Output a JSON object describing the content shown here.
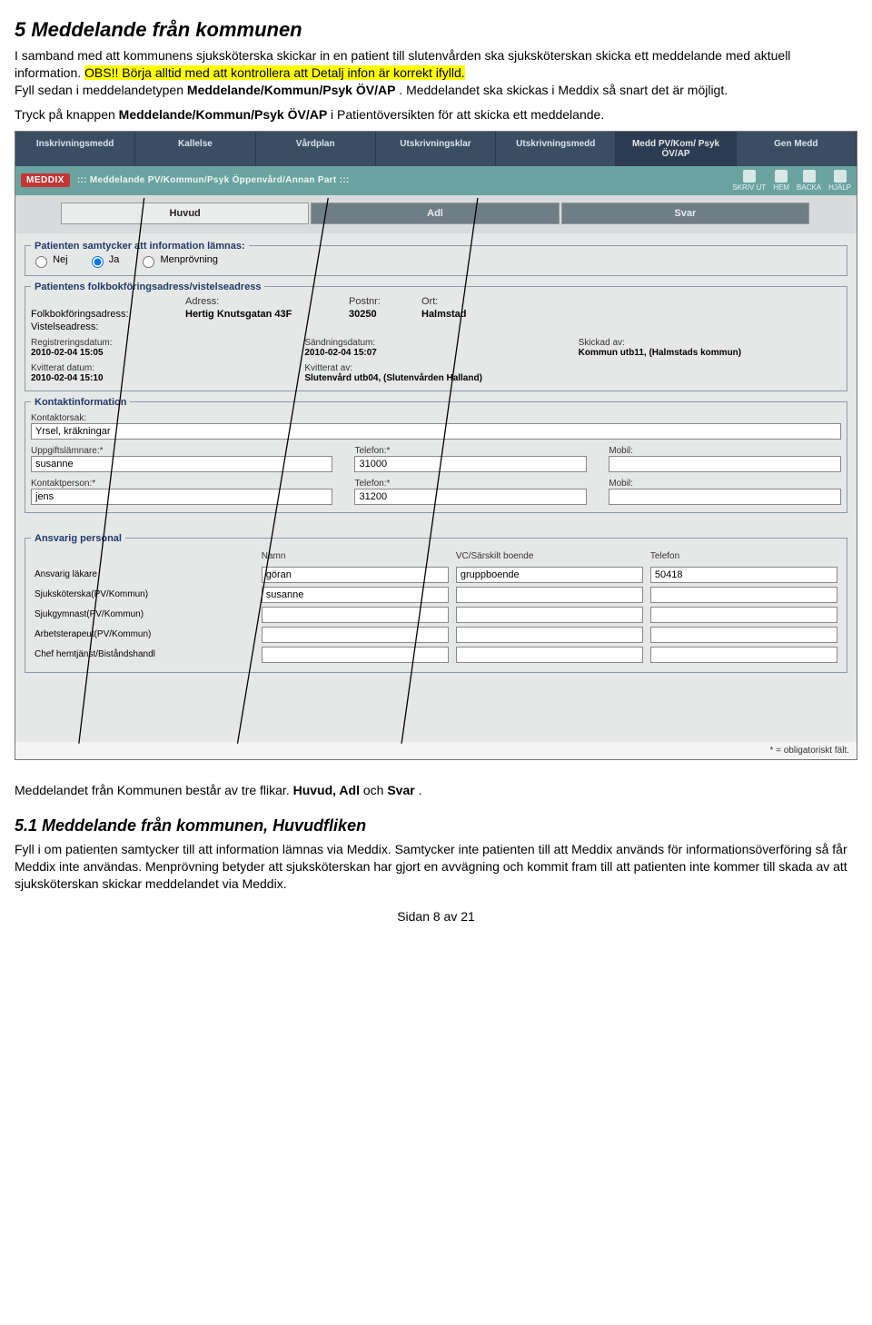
{
  "heading": "5 Meddelande från kommunen",
  "intro_plain": "I samband med att kommunens sjuksköterska skickar in en patient till slutenvården ska sjuksköterskan skicka ett meddelande med aktuell information. ",
  "intro_hl1": "OBS!! Börja alltid med att kontrollera att Detalj infon är korrekt ifylld.",
  "intro_plain2": "Fyll sedan i meddelandetypen ",
  "intro_bold1": "Meddelande/Kommun/Psyk ÖV/AP",
  "intro_plain3": ". Meddelandet ska skickas i Meddix så snart det är möjligt.",
  "preclick1": "Tryck på knappen ",
  "preclick_bold": "Meddelande/Kommun/Psyk ÖV/AP",
  "preclick2": " i Patientöversikten för att skicka ett meddelande.",
  "topnav": [
    "Inskrivningsmedd",
    "Kallelse",
    "Vårdplan",
    "Utskrivningsklar",
    "Utskrivningsmedd",
    "Medd PV/Kom/ Psyk ÖV/AP",
    "Gen Medd"
  ],
  "meddix_logo": "MEDDIX",
  "meddix_title": "::: Meddelande PV/Kommun/Psyk Öppenvård/Annan Part :::",
  "meddix_icons": [
    "SKRIV UT",
    "HEM",
    "BACKA",
    "HJÄLP"
  ],
  "subtabs": [
    "Huvud",
    "Adl",
    "Svar"
  ],
  "consent": {
    "legend": "Patienten samtycker att information lämnas:",
    "options": [
      "Nej",
      "Ja",
      "Menprövning"
    ],
    "selected": "Ja"
  },
  "address": {
    "legend": "Patientens folkbokföringsadress/vistelseadress",
    "hdr_adress": "Adress:",
    "hdr_postnr": "Postnr:",
    "hdr_ort": "Ort:",
    "folk_label": "Folkbokföringsadress:",
    "folk_adress": "Hertig Knutsgatan 43F",
    "folk_postnr": "30250",
    "folk_ort": "Halmstad",
    "vist_label": "Vistelseadress:"
  },
  "meta": {
    "reg_lbl": "Registreringsdatum:",
    "reg_val": "2010-02-04 15:05",
    "send_lbl": "Sändningsdatum:",
    "send_val": "2010-02-04 15:07",
    "sent_lbl": "Skickad av:",
    "sent_val": "Kommun utb11, (Halmstads kommun)",
    "kv_date_lbl": "Kvitterat datum:",
    "kv_date_val": "2010-02-04 15:10",
    "kv_av_lbl": "Kvitterat av:",
    "kv_av_val": "Slutenvård utb04, (Slutenvården Halland)"
  },
  "contact": {
    "legend": "Kontaktinformation",
    "orsak_lbl": "Kontaktorsak:",
    "orsak_val": "Yrsel, kräkningar",
    "uppg_lbl": "Uppgiftslämnare:*",
    "uppg_val": "susanne",
    "uppg_tel_lbl": "Telefon:*",
    "uppg_tel_val": "31000",
    "uppg_mob_lbl": "Mobil:",
    "uppg_mob_val": "",
    "kont_lbl": "Kontaktperson:*",
    "kont_val": "jens",
    "kont_tel_lbl": "Telefon:*",
    "kont_tel_val": "31200",
    "kont_mob_lbl": "Mobil:",
    "kont_mob_val": ""
  },
  "personnel": {
    "legend": "Ansvarig personal",
    "hdr_namn": "Namn",
    "hdr_vc": "VC/Särskilt boende",
    "hdr_tel": "Telefon",
    "rows": [
      {
        "role": "Ansvarig läkare",
        "namn": "göran",
        "vc": "gruppboende",
        "tel": "50418"
      },
      {
        "role": "Sjuksköterska(PV/Kommun)",
        "namn": "susanne",
        "vc": "",
        "tel": ""
      },
      {
        "role": "Sjukgymnast(PV/Kommun)",
        "namn": "",
        "vc": "",
        "tel": ""
      },
      {
        "role": "Arbetsterapeut(PV/Kommun)",
        "namn": "",
        "vc": "",
        "tel": ""
      },
      {
        "role": "Chef hemtjänst/Biståndshandl",
        "namn": "",
        "vc": "",
        "tel": ""
      }
    ]
  },
  "obligatory": "* = obligatoriskt fält.",
  "after1": "Meddelandet från Kommunen består av tre flikar. ",
  "after_bold": "Huvud, Adl",
  "after2": " och ",
  "after_bold2": "Svar",
  "after3": ".",
  "subheading": "5.1 Meddelande från kommunen, Huvudfliken",
  "bodytext": "Fyll i om patienten samtycker till att information lämnas via Meddix.   Samtycker inte patienten till att Meddix används för informationsöverföring så får Meddix inte användas. Menprövning betyder att sjuksköterskan har gjort en avvägning och kommit fram till att patienten inte kommer till skada av att sjuksköterskan skickar meddelandet via Meddix.",
  "pagenr": "Sidan 8 av 21"
}
